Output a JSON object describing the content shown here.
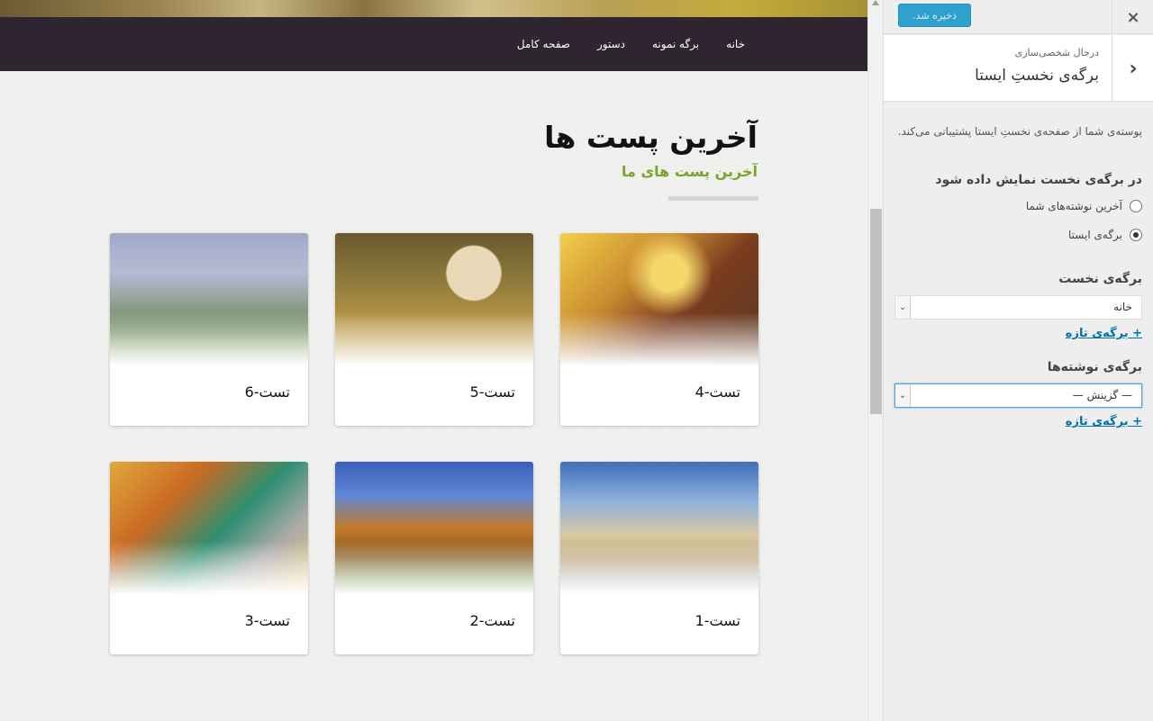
{
  "site_nav": {
    "items": [
      "خانه",
      "برگه نمونه",
      "دستور",
      "صفحه کامل"
    ]
  },
  "section": {
    "title": "آخرین پست ها",
    "subtitle": "آخرین پست های ما"
  },
  "posts": [
    {
      "title": "تست-4",
      "image": "girl-in-sunlight"
    },
    {
      "title": "تست-5",
      "image": "puppy-with-flowers"
    },
    {
      "title": "تست-6",
      "image": "elephants-in-mist"
    },
    {
      "title": "تست-1",
      "image": "mosque"
    },
    {
      "title": "تست-2",
      "image": "autumn-tractor"
    },
    {
      "title": "تست-3",
      "image": "couple-in-autumn"
    }
  ],
  "customizer": {
    "save_label": "ذخیره شد.",
    "close_icon": "×",
    "back_icon": "‹",
    "customizing_label": "درحال شخصی‌سازی",
    "section_name": "برگه‌ی نخستِ ایستا",
    "description": "پوسته‌ی شما از صفحه‌ی نخستِ ایستا پشتیبانی می‌کند.",
    "display_heading": "در برگه‌ی نخست نمایش داده شود",
    "radio_options": [
      {
        "label": "آخرین نوشته‌های شما",
        "checked": false
      },
      {
        "label": "برگه‌ی ایستا",
        "checked": true
      }
    ],
    "front_page": {
      "label": "برگه‌ی نخست",
      "value": "خانه",
      "add_link": "+ برگه‌ی تازه"
    },
    "posts_page": {
      "label": "برگه‌ی نوشته‌ها",
      "value": "— گزینش —",
      "add_link": "+ برگه‌ی تازه"
    }
  },
  "colors": {
    "nav_bg": "#2e2530",
    "subtitle": "#7aa32c",
    "save_button": "#2ea2cc",
    "link": "#0073aa"
  }
}
